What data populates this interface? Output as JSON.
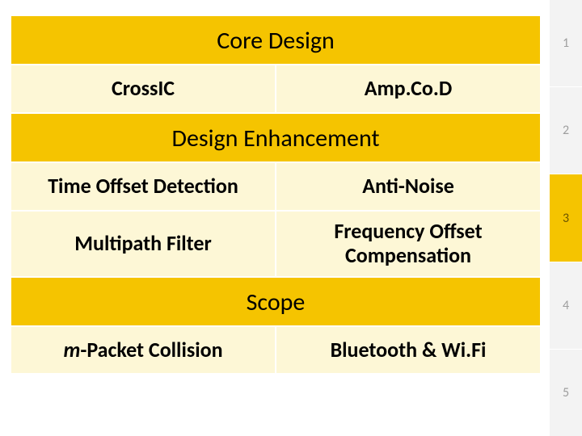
{
  "sections": {
    "core_design": {
      "title": "Core Design",
      "left": "CrossIC",
      "right": "Amp.Co.D"
    },
    "design_enhancement": {
      "title": "Design Enhancement",
      "row1_left": "Time Offset Detection",
      "row1_right": "Anti-Noise",
      "row2_left": "Multipath Filter",
      "row2_right": "Frequency Offset Compensation"
    },
    "scope": {
      "title": "Scope",
      "left_prefix": "m",
      "left_rest": "-Packet Collision",
      "right": "Bluetooth & Wi.Fi"
    }
  },
  "pager": {
    "items": [
      "1",
      "2",
      "3",
      "4",
      "5"
    ],
    "active_index": 2
  }
}
